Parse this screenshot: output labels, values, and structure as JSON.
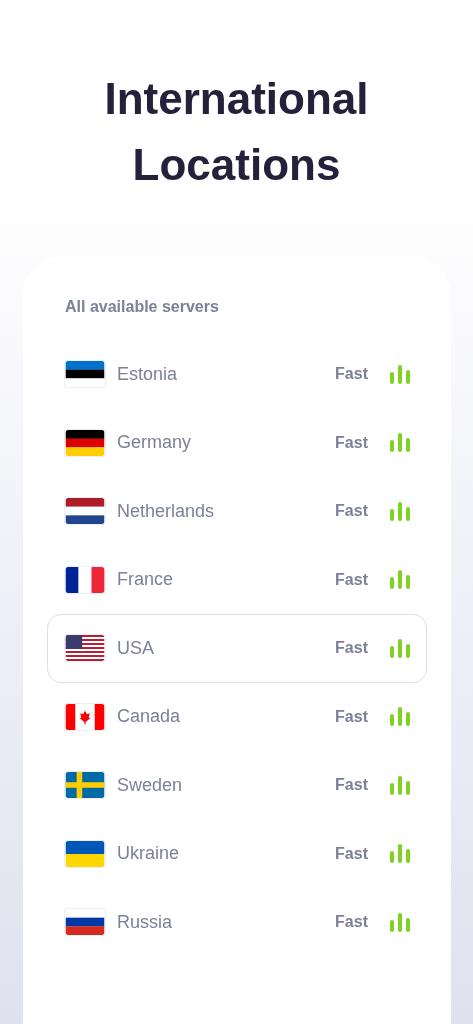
{
  "title": "International Locations",
  "servers": {
    "heading": "All available servers",
    "rows": [
      {
        "name": "Estonia",
        "speed": "Fast",
        "selected": false
      },
      {
        "name": "Germany",
        "speed": "Fast",
        "selected": false
      },
      {
        "name": "Netherlands",
        "speed": "Fast",
        "selected": false
      },
      {
        "name": "France",
        "speed": "Fast",
        "selected": false
      },
      {
        "name": "USA",
        "speed": "Fast",
        "selected": true
      },
      {
        "name": "Canada",
        "speed": "Fast",
        "selected": false
      },
      {
        "name": "Sweden",
        "speed": "Fast",
        "selected": false
      },
      {
        "name": "Ukraine",
        "speed": "Fast",
        "selected": false
      },
      {
        "name": "Russia",
        "speed": "Fast",
        "selected": false
      }
    ]
  }
}
